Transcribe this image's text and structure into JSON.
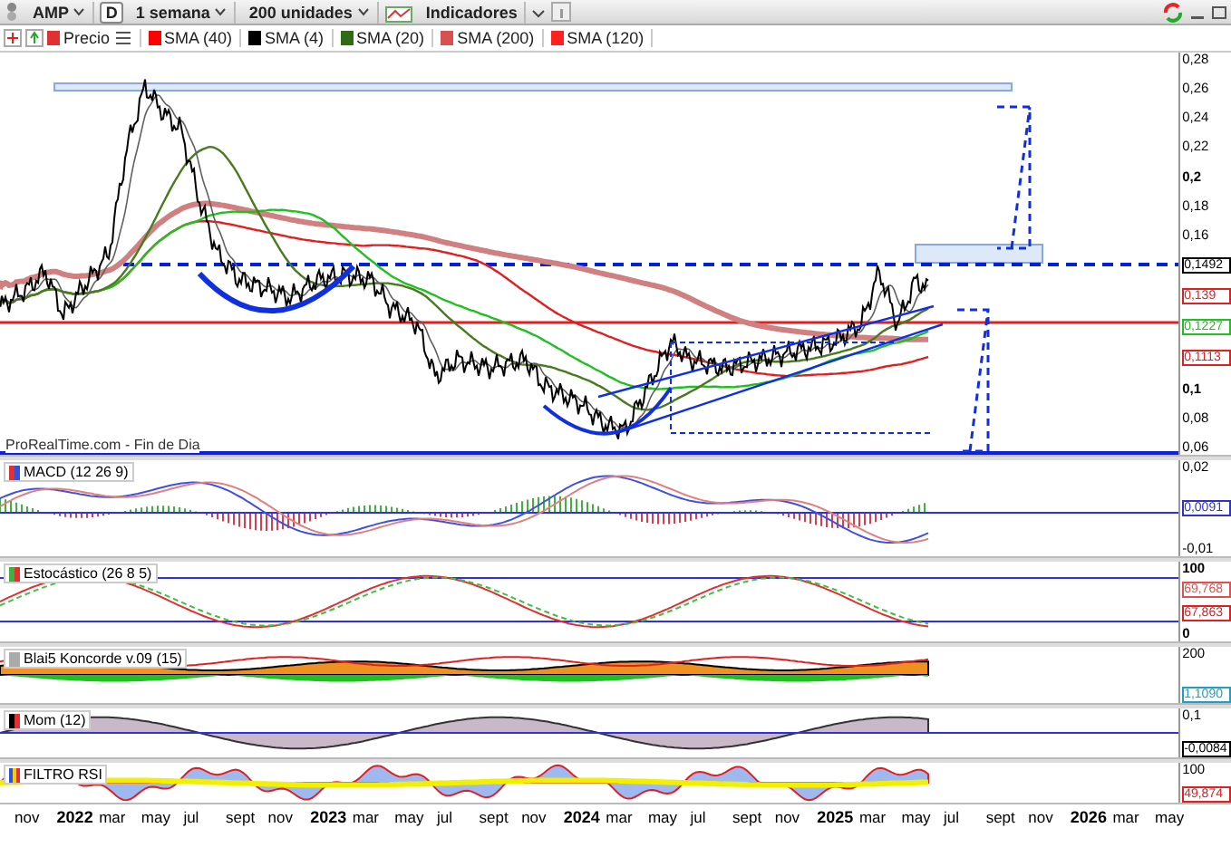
{
  "toolbar": {
    "symbol": "AMP",
    "period_key": "D",
    "period": "1 semana",
    "units": "200 unidades",
    "indicators": "Indicadores"
  },
  "legend": [
    {
      "label": "Precio",
      "color": "#e03030"
    },
    {
      "label": "SMA (40)",
      "color": "#ff0000"
    },
    {
      "label": "SMA (4)",
      "color": "#000000"
    },
    {
      "label": "SMA (20)",
      "color": "#2e6b12"
    },
    {
      "label": "SMA (200)",
      "color": "#d85050"
    },
    {
      "label": "SMA (120)",
      "color": "#ff2020"
    }
  ],
  "main_panel": {
    "source": "ProRealTime.com - Fin de Dia",
    "axis": [
      {
        "kind": "tick",
        "text": "0,28",
        "bold": false
      },
      {
        "kind": "tick",
        "text": "0,26",
        "bold": false
      },
      {
        "kind": "tick",
        "text": "0,24",
        "bold": false
      },
      {
        "kind": "tick",
        "text": "0,22",
        "bold": false
      },
      {
        "kind": "tick",
        "text": "0,2",
        "bold": true
      },
      {
        "kind": "tick",
        "text": "0,18",
        "bold": false
      },
      {
        "kind": "tick",
        "text": "0,16",
        "bold": false
      },
      {
        "kind": "tag",
        "text": "0,1492",
        "color": "#000000"
      },
      {
        "kind": "tag",
        "text": "0,139",
        "color": "#e02020"
      },
      {
        "kind": "tag",
        "text": "0,1227",
        "color": "#20c020"
      },
      {
        "kind": "tag",
        "text": "0,1113",
        "color": "#e02020"
      },
      {
        "kind": "tick",
        "text": "0,1",
        "bold": true
      },
      {
        "kind": "tick",
        "text": "0,08",
        "bold": false
      },
      {
        "kind": "tick",
        "text": "0,06",
        "bold": false
      }
    ]
  },
  "panels": [
    {
      "kind": "macd",
      "title": "MACD (12 26 9)",
      "axis": [
        {
          "kind": "tick",
          "text": "0,02",
          "bold": false
        },
        {
          "kind": "tag",
          "text": "0,0091",
          "color": "#3030d0"
        },
        {
          "kind": "tick",
          "text": "-0,01",
          "bold": false
        }
      ]
    },
    {
      "kind": "stoch",
      "title": "Estocástico (26 8 5)",
      "axis": [
        {
          "kind": "tick",
          "text": "100",
          "bold": true
        },
        {
          "kind": "tag",
          "text": "69,768",
          "color": "#e05050"
        },
        {
          "kind": "tag",
          "text": "67,863",
          "color": "#e02020"
        },
        {
          "kind": "tick",
          "text": "0",
          "bold": true
        }
      ]
    },
    {
      "kind": "blai5",
      "title": "Blai5 Koncorde v.09 (15)",
      "axis": [
        {
          "kind": "tick",
          "text": "200",
          "bold": false
        },
        {
          "kind": "tag",
          "text": "1,1090",
          "color": "#20a0c0"
        }
      ]
    },
    {
      "kind": "mom",
      "title": "Mom (12)",
      "axis": [
        {
          "kind": "tick",
          "text": "0,1",
          "bold": false
        },
        {
          "kind": "tag",
          "text": "-0,0084",
          "color": "#000000"
        }
      ]
    },
    {
      "kind": "rsi",
      "title": "FILTRO RSI",
      "axis": [
        {
          "kind": "tick",
          "text": "100",
          "bold": false
        },
        {
          "kind": "tag",
          "text": "49,874",
          "color": "#e02020"
        }
      ]
    }
  ],
  "x_axis": [
    {
      "text": "nov",
      "year": false
    },
    {
      "text": "2022",
      "year": true
    },
    {
      "text": "mar",
      "year": false
    },
    {
      "text": "may",
      "year": false
    },
    {
      "text": "jul",
      "year": false
    },
    {
      "text": "sept",
      "year": false
    },
    {
      "text": "nov",
      "year": false
    },
    {
      "text": "2023",
      "year": true
    },
    {
      "text": "mar",
      "year": false
    },
    {
      "text": "may",
      "year": false
    },
    {
      "text": "jul",
      "year": false
    },
    {
      "text": "sept",
      "year": false
    },
    {
      "text": "nov",
      "year": false
    },
    {
      "text": "2024",
      "year": true
    },
    {
      "text": "mar",
      "year": false
    },
    {
      "text": "may",
      "year": false
    },
    {
      "text": "jul",
      "year": false
    },
    {
      "text": "sept",
      "year": false
    },
    {
      "text": "nov",
      "year": false
    },
    {
      "text": "2025",
      "year": true
    },
    {
      "text": "mar",
      "year": false
    },
    {
      "text": "may",
      "year": false
    },
    {
      "text": "jul",
      "year": false
    },
    {
      "text": "sept",
      "year": false
    },
    {
      "text": "nov",
      "year": false
    },
    {
      "text": "2026",
      "year": true
    },
    {
      "text": "mar",
      "year": false
    },
    {
      "text": "may",
      "year": false
    }
  ]
}
